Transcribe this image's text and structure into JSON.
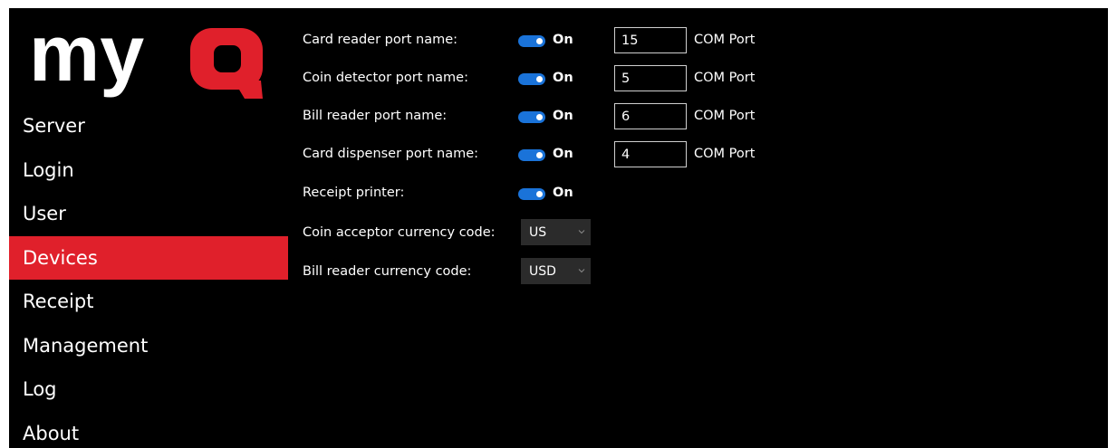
{
  "app": {
    "logo_text": "myQ",
    "accent_color": "#e0202b",
    "toggle_color": "#1a73d9"
  },
  "nav": {
    "items": [
      {
        "label": "Server"
      },
      {
        "label": "Login"
      },
      {
        "label": "User"
      },
      {
        "label": "Devices",
        "active": true
      },
      {
        "label": "Receipt"
      },
      {
        "label": "Management"
      },
      {
        "label": "Log"
      },
      {
        "label": "About"
      }
    ]
  },
  "devices": {
    "card_reader": {
      "label": "Card reader port name:",
      "toggle": "On",
      "port": "15",
      "unit": "COM Port"
    },
    "coin_detector": {
      "label": "Coin detector port name:",
      "toggle": "On",
      "port": "5",
      "unit": "COM Port"
    },
    "bill_reader": {
      "label": "Bill reader port name:",
      "toggle": "On",
      "port": "6",
      "unit": "COM Port"
    },
    "card_dispenser": {
      "label": "Card dispenser port name:",
      "toggle": "On",
      "port": "4",
      "unit": "COM Port"
    },
    "receipt_printer": {
      "label": "Receipt printer:",
      "toggle": "On"
    },
    "coin_currency": {
      "label": "Coin acceptor currency code:",
      "value": "US"
    },
    "bill_currency": {
      "label": "Bill reader currency code:",
      "value": "USD"
    }
  }
}
